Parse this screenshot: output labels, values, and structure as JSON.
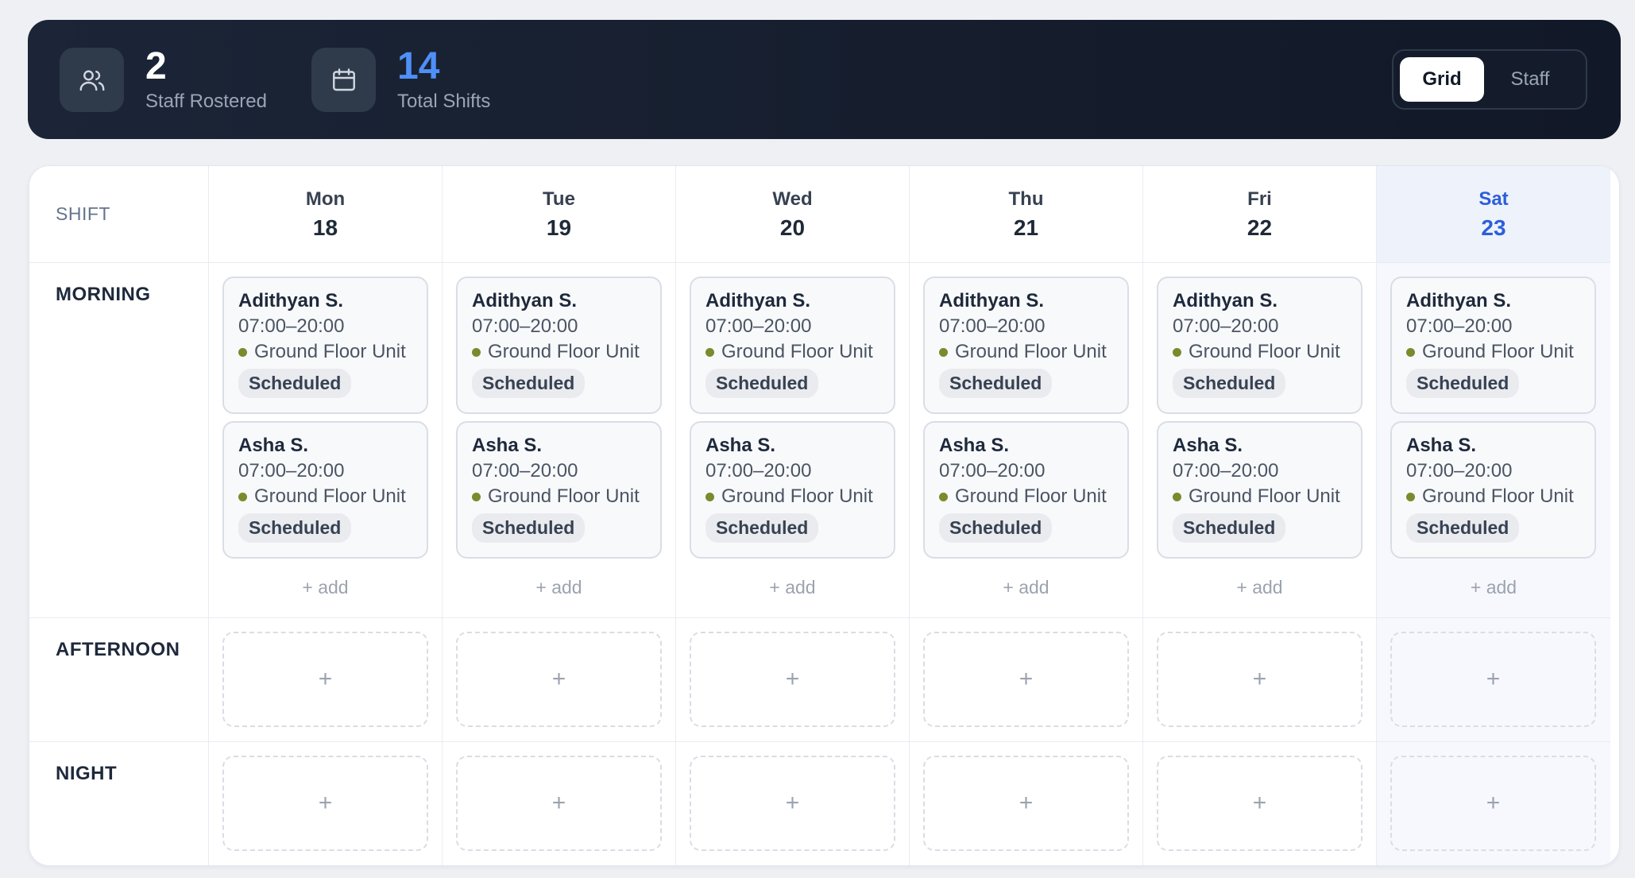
{
  "header": {
    "staff_rostered": {
      "value": "2",
      "label": "Staff Rostered",
      "icon": "users-icon"
    },
    "total_shifts": {
      "value": "14",
      "label": "Total Shifts",
      "icon": "calendar-icon"
    },
    "view_toggle": {
      "grid_label": "Grid",
      "staff_label": "Staff",
      "active": "Grid"
    }
  },
  "grid": {
    "corner_label": "SHIFT",
    "days": [
      {
        "name": "Mon",
        "num": "18"
      },
      {
        "name": "Tue",
        "num": "19"
      },
      {
        "name": "Wed",
        "num": "20"
      },
      {
        "name": "Thu",
        "num": "21"
      },
      {
        "name": "Fri",
        "num": "22"
      },
      {
        "name": "Sat",
        "num": "23",
        "highlighted": true
      }
    ],
    "rows": {
      "morning": "MORNING",
      "afternoon": "AFTERNOON",
      "night": "NIGHT"
    },
    "morning_shifts": [
      {
        "name": "Adithyan S.",
        "time": "07:00–20:00",
        "location": "Ground Floor Unit",
        "status": "Scheduled"
      },
      {
        "name": "Asha S.",
        "time": "07:00–20:00",
        "location": "Ground Floor Unit",
        "status": "Scheduled"
      }
    ],
    "add_label": "+ add",
    "empty_slot_label": "+"
  },
  "colors": {
    "header_bg": "#161e2e",
    "accent_blue": "#4f8ff7",
    "highlight_day": "#2b5fd9",
    "location_dot": "#7a8a2d"
  }
}
